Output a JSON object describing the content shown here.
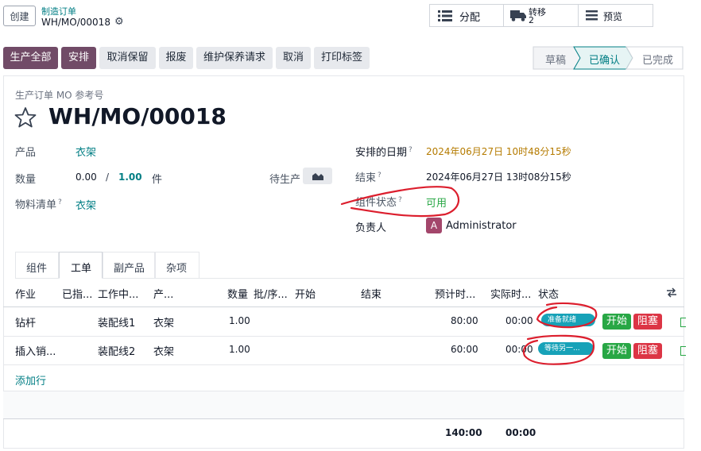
{
  "header": {
    "create_label": "创建",
    "breadcrumb_parent": "制造订单",
    "record_title": "WH/MO/00018"
  },
  "smart_buttons": [
    {
      "label": "分配",
      "icon": "list-icon"
    },
    {
      "label": "转移",
      "count": "2",
      "icon": "truck-icon"
    },
    {
      "label": "预览",
      "icon": "menu-icon"
    }
  ],
  "actions": {
    "produce_all": "生产全部",
    "plan": "安排",
    "unreserve": "取消保留",
    "scrap": "报废",
    "maintenance": "维护保养请求",
    "cancel": "取消",
    "print_labels": "打印标签"
  },
  "statusbar": {
    "draft": "草稿",
    "confirmed": "已确认",
    "done": "已完成"
  },
  "form": {
    "ref_label": "生产订单 MO 参考号",
    "ref_value": "WH/MO/00018",
    "product_label": "产品",
    "product_value": "衣架",
    "qty_label": "数量",
    "qty_produced": "0.00",
    "qty_sep": "/",
    "qty_total": "1.00",
    "qty_uom": "件",
    "to_produce_label": "待生产",
    "bom_label": "物料清单",
    "tip": "?",
    "bom_value": "衣架",
    "scheduled_label": "安排的日期",
    "scheduled_value": "2024年06月27日 10时48分15秒",
    "end_label": "结束",
    "end_value": "2024年06月27日 13时08分15秒",
    "components_label": "组件状态",
    "components_value": "可用",
    "responsible_label": "负责人",
    "responsible_avatar": "A",
    "responsible_value": "Administrator"
  },
  "tabs": [
    "组件",
    "工单",
    "副产品",
    "杂项"
  ],
  "workorders": {
    "headers": [
      "作业",
      "已指...",
      "工作中...",
      "产...",
      "数量",
      "批/序...",
      "开始",
      "结束",
      "预计时...",
      "实际时...",
      "状态"
    ],
    "rows": [
      {
        "operation": "钻杆",
        "workcenter": "装配线1",
        "product": "衣架",
        "qty": "1.00",
        "expected": "80:00",
        "actual": "00:00",
        "status": "准备就绪",
        "start": "开始",
        "block": "阻塞"
      },
      {
        "operation": "插入销...",
        "workcenter": "装配线2",
        "product": "衣架",
        "qty": "1.00",
        "expected": "60:00",
        "actual": "00:00",
        "status": "等待另一...",
        "start": "开始",
        "block": "阻塞"
      }
    ],
    "add_line": "添加行",
    "total_expected": "140:00",
    "total_actual": "00:00"
  },
  "colors": {
    "brand": "#714b67",
    "teal": "#017e84",
    "annotation": "#dc1e2d"
  }
}
